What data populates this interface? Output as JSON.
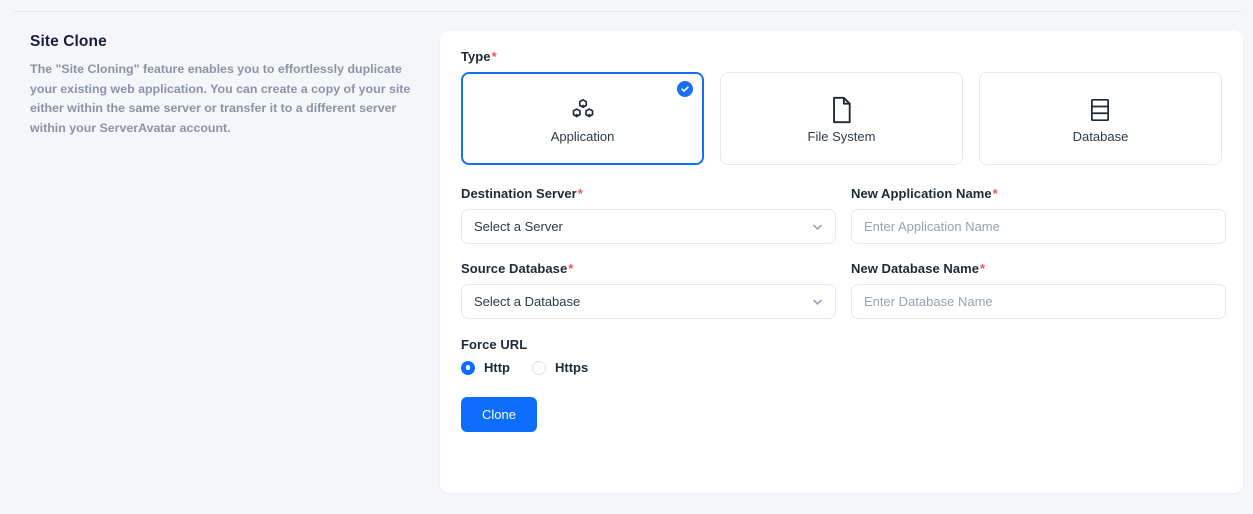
{
  "info": {
    "title": "Site Clone",
    "description": "The \"Site Cloning\" feature enables you to effortlessly duplicate your existing web application. You can create a copy of your site either within the same server or transfer it to a different server within your ServerAvatar account."
  },
  "form": {
    "type": {
      "label": "Type",
      "required_marker": "*",
      "options": [
        {
          "label": "Application",
          "icon": "boxes-icon",
          "selected": true
        },
        {
          "label": "File System",
          "icon": "file-icon",
          "selected": false
        },
        {
          "label": "Database",
          "icon": "database-icon",
          "selected": false
        }
      ]
    },
    "destination_server": {
      "label": "Destination Server",
      "required_marker": "*",
      "value": "Select a Server"
    },
    "new_application_name": {
      "label": "New Application Name",
      "required_marker": "*",
      "value": "",
      "placeholder": "Enter Application Name"
    },
    "source_database": {
      "label": "Source Database",
      "required_marker": "*",
      "value": "Select a Database"
    },
    "new_database_name": {
      "label": "New Database Name",
      "required_marker": "*",
      "value": "",
      "placeholder": "Enter Database Name"
    },
    "force_url": {
      "label": "Force URL",
      "options": [
        {
          "label": "Http",
          "selected": true
        },
        {
          "label": "Https",
          "selected": false
        }
      ]
    },
    "submit_label": "Clone"
  },
  "colors": {
    "accent": "#0d6efd",
    "selected_border": "#1b6ff3",
    "required": "#f2545b",
    "page_background": "#f4f6fa",
    "panel_background": "#ffffff",
    "muted_text": "#8a94a6"
  }
}
